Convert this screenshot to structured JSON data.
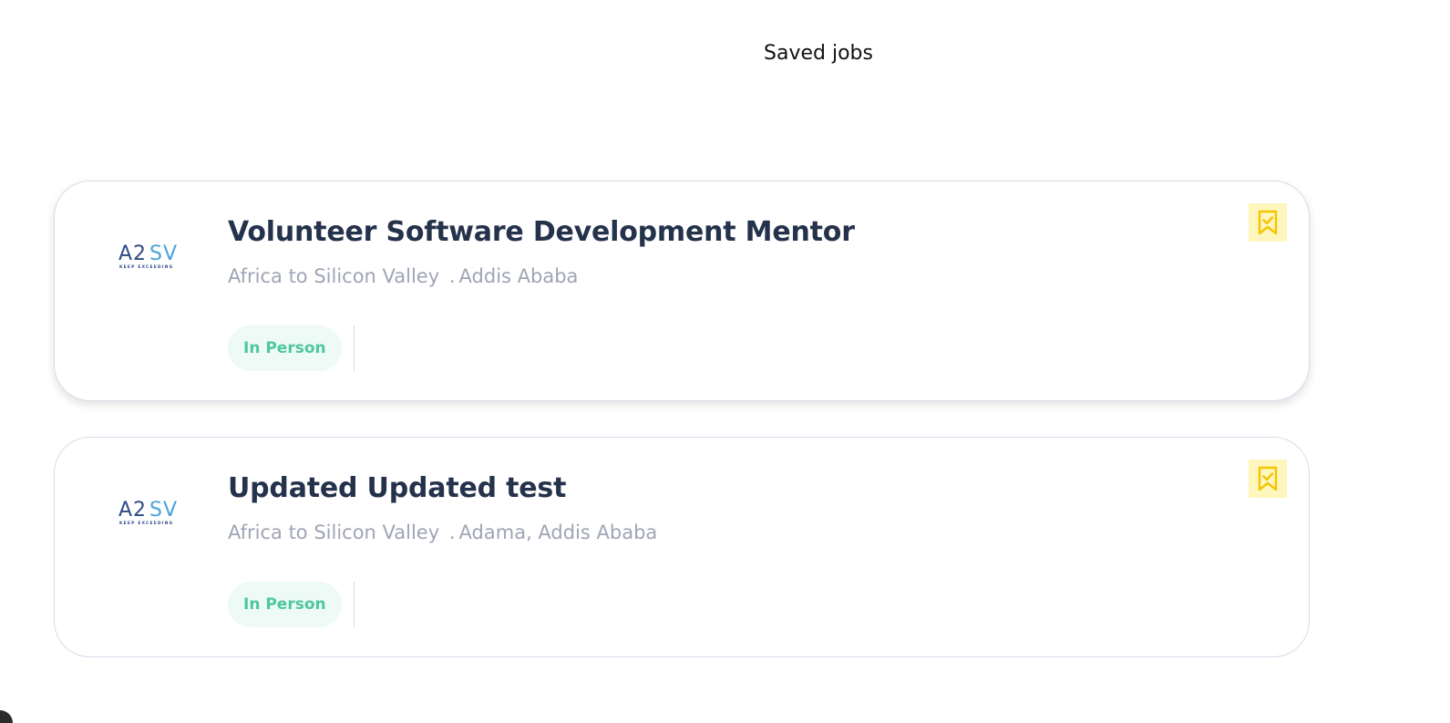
{
  "page": {
    "title": "Saved jobs"
  },
  "jobs": [
    {
      "title": "Volunteer Software Development Mentor",
      "company": "Africa to Silicon Valley",
      "separator": ".",
      "location": "Addis Ababa",
      "tags": [
        "In Person"
      ],
      "logo_text": "A2SV",
      "logo_tagline": "KEEP EXCEEDING",
      "bookmarked": true
    },
    {
      "title": "Updated Updated test",
      "company": "Africa to Silicon Valley",
      "separator": ".",
      "location": "Adama, Addis Ababa",
      "tags": [
        "In Person"
      ],
      "logo_text": "A2SV",
      "logo_tagline": "KEEP EXCEEDING",
      "bookmarked": true
    }
  ],
  "colors": {
    "title": "#25324b",
    "subtitle": "#a0a4b4",
    "tag_text": "#4fc7a0",
    "tag_bg": "#eefaf5",
    "bookmark_bg": "#fff6bd",
    "bookmark_icon": "#f5c400",
    "card_border": "#d6dbe8",
    "logo_dark": "#2e4a86",
    "logo_light": "#4aa3d8"
  },
  "icons": {
    "bookmark": "bookmark-check-icon",
    "logo": "a2sv-logo-icon"
  }
}
